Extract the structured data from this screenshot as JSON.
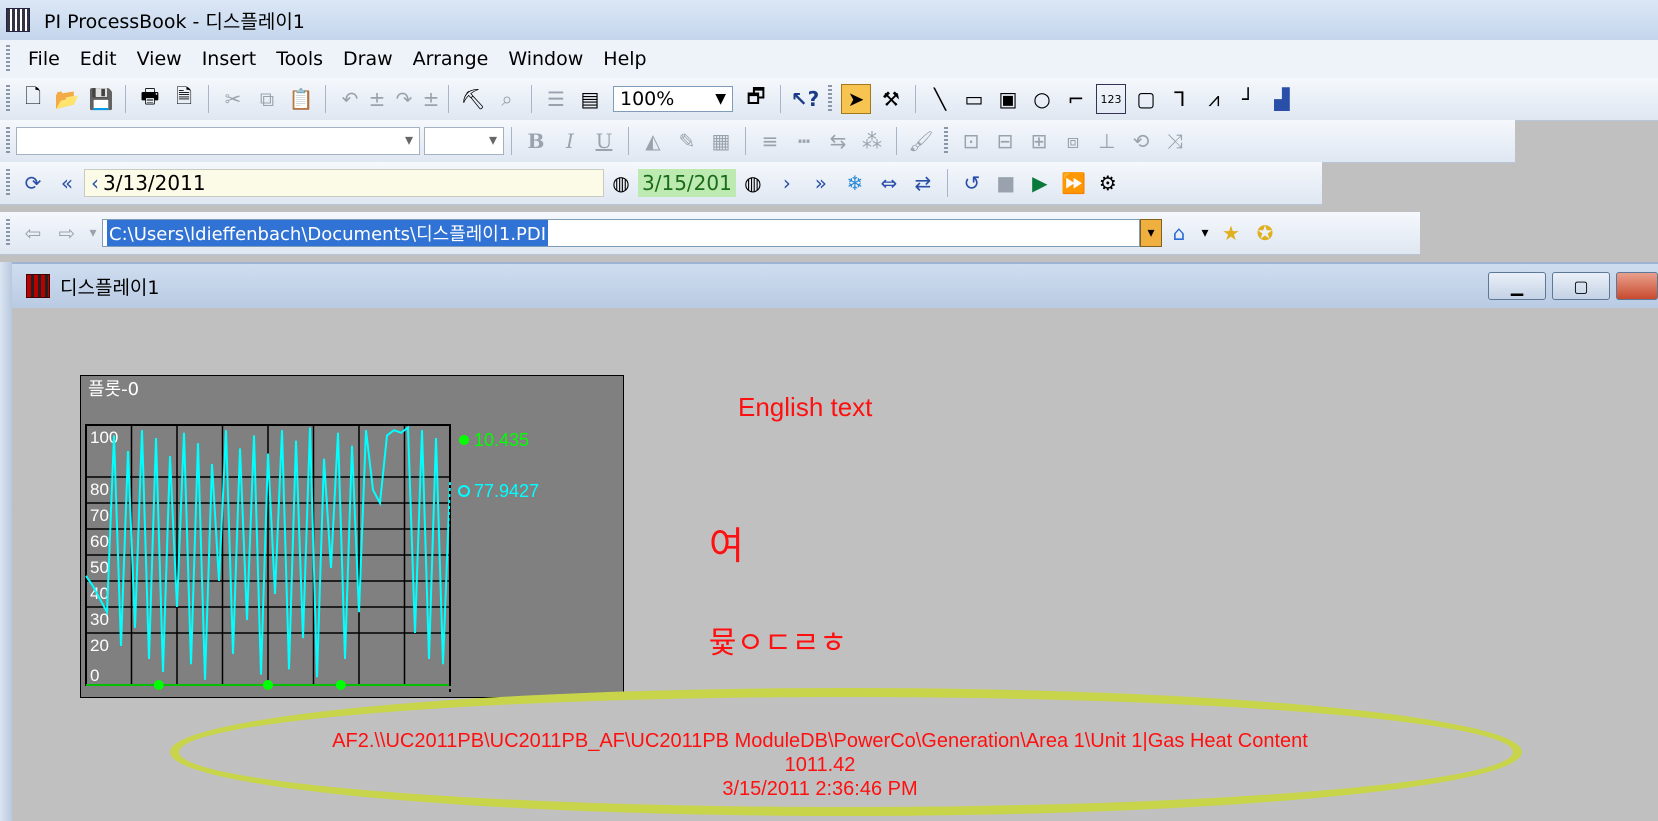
{
  "window": {
    "title": "PI ProcessBook - 디스플레이1"
  },
  "menu": [
    "File",
    "Edit",
    "View",
    "Insert",
    "Tools",
    "Draw",
    "Arrange",
    "Window",
    "Help"
  ],
  "toolbar": {
    "zoom": "100%"
  },
  "timebar": {
    "start": "3/13/2011",
    "end": "3/15/201"
  },
  "address": {
    "path": "C:\\Users\\ldieffenbach\\Documents\\디스플레이1.PDI"
  },
  "child_window": {
    "title": "디스플레이1"
  },
  "display": {
    "text_english": "English text",
    "text_korean_1": "여",
    "text_korean_2": "뮻ㅇㄷㄹㅎ",
    "info_path": "AF2.\\\\UC2011PB\\UC2011PB_AF\\UC2011PB ModuleDB\\PowerCo\\Generation\\Area 1\\Unit 1|Gas Heat Content",
    "info_value": "1011.42",
    "info_time": "3/15/2011 2:36:46 PM"
  },
  "chart_data": {
    "type": "line",
    "title": "플롯-0",
    "ylim": [
      0,
      100
    ],
    "yticks": [
      "100",
      "80",
      "70",
      "60",
      "50",
      "40",
      "30",
      "20",
      "0"
    ],
    "grid": true,
    "series": [
      {
        "name": "",
        "color": "#00ffff",
        "current_value": "77.9427",
        "values": [
          42,
          38,
          33,
          28,
          96,
          15,
          90,
          22,
          98,
          10,
          95,
          5,
          88,
          30,
          97,
          8,
          93,
          2,
          85,
          40,
          98,
          12,
          91,
          25,
          96,
          4,
          89,
          35,
          98,
          6,
          94,
          18,
          99,
          3,
          87,
          45,
          97,
          10,
          92,
          28,
          98,
          75,
          70,
          96,
          98,
          97,
          99,
          20,
          98,
          10,
          95,
          8,
          78
        ]
      },
      {
        "name": "",
        "color": "#00ff00",
        "current_value": "10.435",
        "values": [
          0,
          0,
          0,
          0,
          0,
          0,
          0,
          0,
          0,
          0,
          0
        ]
      }
    ]
  },
  "colors": {
    "accent_text": "#ff1010",
    "highlight_ellipse": "#c8d44a",
    "cyan_series": "#00ffff",
    "green_series": "#00ff00"
  }
}
